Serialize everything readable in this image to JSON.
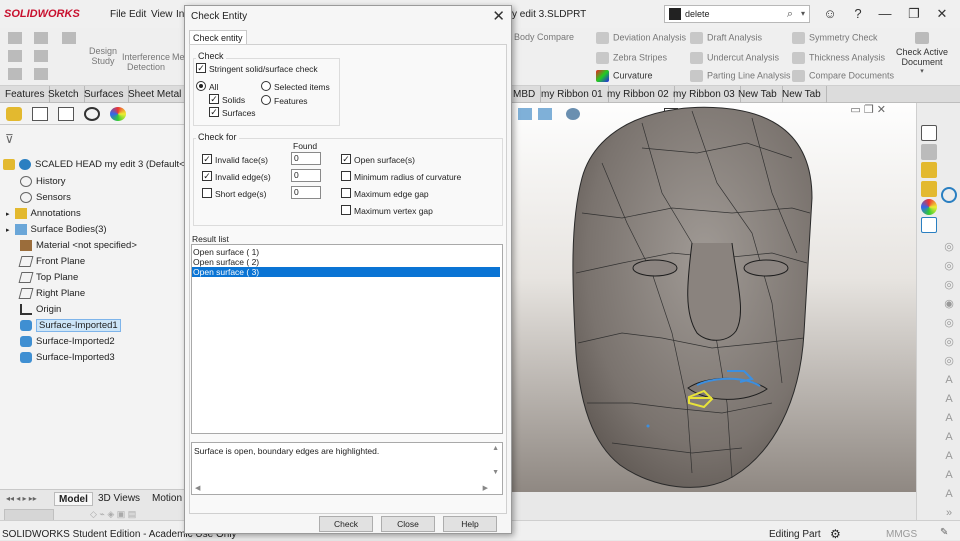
{
  "app": {
    "logo": "SOLIDWORKS",
    "menu": [
      "File",
      "Edit",
      "View",
      "In"
    ],
    "doc_title": "y edit 3.SLDPRT",
    "search_value": "delete"
  },
  "command_manager": {
    "left": [
      {
        "label": "Design\nStudy"
      },
      {
        "label": "Interference\nDetection"
      },
      {
        "label": "Me"
      }
    ],
    "items": [
      {
        "label": "Body Compare"
      },
      {
        "label": "Deviation Analysis"
      },
      {
        "label": "Zebra Stripes"
      },
      {
        "label": "Curvature"
      },
      {
        "label": "Draft Analysis"
      },
      {
        "label": "Undercut Analysis"
      },
      {
        "label": "Parting Line Analysis"
      },
      {
        "label": "Symmetry Check"
      },
      {
        "label": "Thickness Analysis"
      },
      {
        "label": "Compare Documents"
      }
    ],
    "check_active": "Check Active\nDocument"
  },
  "tabs": [
    "Features",
    "Sketch",
    "Surfaces",
    "Sheet Metal",
    "MBD",
    "my Ribbon 01",
    "my Ribbon 02",
    "my Ribbon 03",
    "New Tab",
    "New Tab"
  ],
  "tree": {
    "root": "SCALED HEAD my edit 3  (Default<<",
    "items": [
      {
        "label": "History"
      },
      {
        "label": "Sensors"
      },
      {
        "label": "Annotations"
      },
      {
        "label": "Surface Bodies(3)"
      },
      {
        "label": "Material <not specified>"
      },
      {
        "label": "Front Plane"
      },
      {
        "label": "Top Plane"
      },
      {
        "label": "Right Plane"
      },
      {
        "label": "Origin"
      },
      {
        "label": "Surface-Imported1"
      },
      {
        "label": "Surface-Imported2"
      },
      {
        "label": "Surface-Imported3"
      }
    ]
  },
  "bottom_tabs": [
    "Model",
    "3D Views",
    "Motion"
  ],
  "status": {
    "left": "SOLIDWORKS Student Edition - Academic Use Only",
    "editing": "Editing Part",
    "units": "MMGS"
  },
  "dialog": {
    "title": "Check Entity",
    "tab": "Check entity",
    "check_group": "Check",
    "stringent": "Stringent solid/surface check",
    "all": "All",
    "selected_items": "Selected items",
    "solids": "Solids",
    "surfaces": "Surfaces",
    "features": "Features",
    "check_for_group": "Check for",
    "found_label": "Found",
    "checks_left": [
      {
        "label": "Invalid face(s)",
        "checked": true,
        "found": "0"
      },
      {
        "label": "Invalid edge(s)",
        "checked": true,
        "found": "0"
      },
      {
        "label": "Short edge(s)",
        "checked": false,
        "found": "0"
      }
    ],
    "checks_right": [
      {
        "label": "Open surface(s)",
        "checked": true
      },
      {
        "label": "Minimum radius of curvature",
        "checked": false
      },
      {
        "label": "Maximum edge gap",
        "checked": false
      },
      {
        "label": "Maximum vertex gap",
        "checked": false
      }
    ],
    "result_label": "Result list",
    "results": [
      "Open surface (  1)",
      "Open surface (  2)",
      "Open surface (  3)"
    ],
    "message": "Surface is open, boundary edges are highlighted.",
    "buttons": {
      "check": "Check",
      "close": "Close",
      "help": "Help"
    },
    "check_mark": "✓"
  }
}
